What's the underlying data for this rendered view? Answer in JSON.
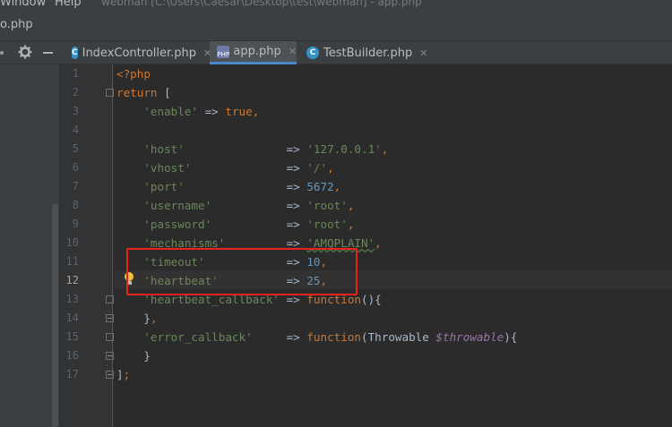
{
  "menu": {
    "window": "Window",
    "help": "Help",
    "title": "webman [C:\\Users\\Caesar\\Desktop\\test\\webman] - app.php"
  },
  "breadcrumb": "o.php",
  "tabs": [
    {
      "label": "IndexController.php",
      "icon": "class-icon"
    },
    {
      "label": "app.php",
      "icon": "php-file-icon",
      "active": true
    },
    {
      "label": "TestBuilder.php",
      "icon": "class-icon"
    }
  ],
  "line_numbers": [
    "1",
    "2",
    "3",
    "4",
    "5",
    "6",
    "7",
    "8",
    "9",
    "10",
    "11",
    "12",
    "13",
    "14",
    "15",
    "16",
    "17"
  ],
  "code": {
    "l1": {
      "open": "<?php"
    },
    "l2": {
      "kw": "return",
      "rest": " ["
    },
    "l3": {
      "key": "'enable'",
      "arrow": " => ",
      "val": "true",
      "tail": ","
    },
    "l5": {
      "key": "'host'",
      "arrow": "               => ",
      "val": "'127.0.0.1'",
      "tail": ","
    },
    "l6": {
      "key": "'vhost'",
      "arrow": "              => ",
      "val": "'/'",
      "tail": ","
    },
    "l7": {
      "key": "'port'",
      "arrow": "               => ",
      "val": "5672",
      "tail": ","
    },
    "l8": {
      "key": "'username'",
      "arrow": "           => ",
      "val": "'root'",
      "tail": ","
    },
    "l9": {
      "key": "'password'",
      "arrow": "           => ",
      "val": "'root'",
      "tail": ","
    },
    "l10": {
      "key": "'mechanisms'",
      "arrow": "         => ",
      "val": "'AMQPLAIN'",
      "tail": ","
    },
    "l11": {
      "key": "'timeout'",
      "arrow": "            => ",
      "val": "10",
      "tail": ","
    },
    "l12": {
      "key": "'heartbeat'",
      "arrow": "          => ",
      "val": "25",
      "tail": ","
    },
    "l13": {
      "key": "'heartbeat_callback'",
      "arrow": " => ",
      "fn": "function",
      "tail": "(){"
    },
    "l14": {
      "text": "}",
      "tail": ","
    },
    "l15": {
      "key": "'error_callback'",
      "arrow": "     => ",
      "fn": "function",
      "paren": "(Throwable ",
      "var": "$throwable",
      "tail": "){"
    },
    "l16": {
      "text": "}"
    },
    "l17": {
      "text": "]",
      "tail": ";"
    }
  },
  "colors": {
    "highlight_box": "#e8221f",
    "bulb": "#f2c13a",
    "tab_underline": "#4a88c7"
  }
}
